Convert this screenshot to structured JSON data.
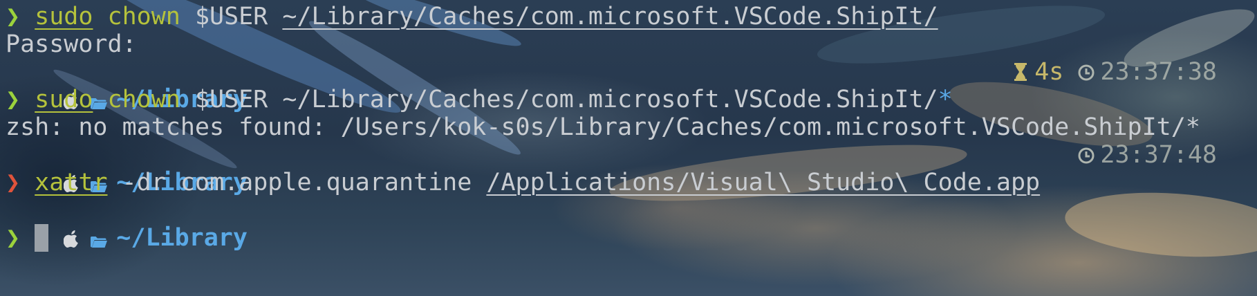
{
  "theme": {
    "accent_blue": "#5aa9e6",
    "prompt_ok_color": "#9bd23c",
    "prompt_error_color": "#e0533b",
    "command_color": "#b5c23c",
    "text_color": "#c9cdd2"
  },
  "lines": [
    {
      "type": "command",
      "status": "ok",
      "prompt_symbol": "❯",
      "command": "sudo",
      "rest_1": " chown",
      "rest_2": " $USER ",
      "path": "~/Library/Caches/com.microsoft.VSCode.ShipIt/"
    },
    {
      "type": "output",
      "text": "Password:"
    },
    {
      "type": "prompt",
      "apple_icon": "apple-icon",
      "folder_icon": "folder-icon",
      "dir": "~/Library",
      "duration_icon": "hourglass-icon",
      "duration": "4s",
      "clock_icon": "clock-icon",
      "time": "23:37:38"
    },
    {
      "type": "command",
      "status": "ok",
      "prompt_symbol": "❯",
      "command": "sudo",
      "rest_1": " chown",
      "rest_2": " $USER ~/Library/Caches/com.microsoft.VSCode.ShipIt/",
      "glob": "*"
    },
    {
      "type": "output",
      "text": "zsh: no matches found: /Users/kok-s0s/Library/Caches/com.microsoft.VSCode.ShipIt/*"
    },
    {
      "type": "prompt",
      "dir": "~/Library",
      "clock_icon": "clock-icon",
      "time": "23:37:48"
    },
    {
      "type": "command",
      "status": "error",
      "prompt_symbol": "❯",
      "command": "xattr",
      "rest": " -dr com.apple.quarantine ",
      "path": "/Applications/Visual\\ Studio\\ Code.app"
    },
    {
      "type": "prompt",
      "dir": "~/Library"
    },
    {
      "type": "input",
      "status": "ok",
      "prompt_symbol": "❯",
      "value": ""
    }
  ]
}
